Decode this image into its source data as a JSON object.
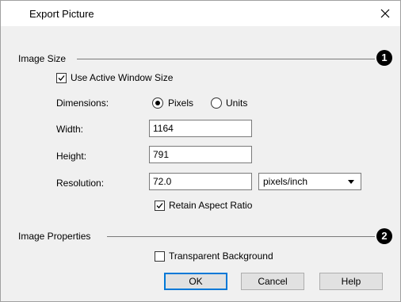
{
  "window": {
    "title": "Export Picture",
    "close_icon": "close-icon"
  },
  "image_size": {
    "label": "Image Size",
    "callout": "1",
    "use_active_window": {
      "label": "Use Active Window Size",
      "checked": true
    },
    "dimensions": {
      "label": "Dimensions:",
      "options": [
        "Pixels",
        "Units"
      ],
      "selected": "Pixels"
    },
    "width": {
      "label": "Width:",
      "value": "1164"
    },
    "height": {
      "label": "Height:",
      "value": "791"
    },
    "resolution": {
      "label": "Resolution:",
      "value": "72.0",
      "unit": "pixels/inch"
    },
    "retain_aspect": {
      "label": "Retain Aspect Ratio",
      "checked": true
    }
  },
  "image_properties": {
    "label": "Image Properties",
    "callout": "2",
    "transparent_background": {
      "label": "Transparent Background",
      "checked": false
    }
  },
  "buttons": {
    "ok": "OK",
    "cancel": "Cancel",
    "help": "Help"
  },
  "colors": {
    "dialog_bg": "#f0f0f0",
    "titlebar_bg": "#ffffff",
    "default_button_border": "#0078d7"
  }
}
